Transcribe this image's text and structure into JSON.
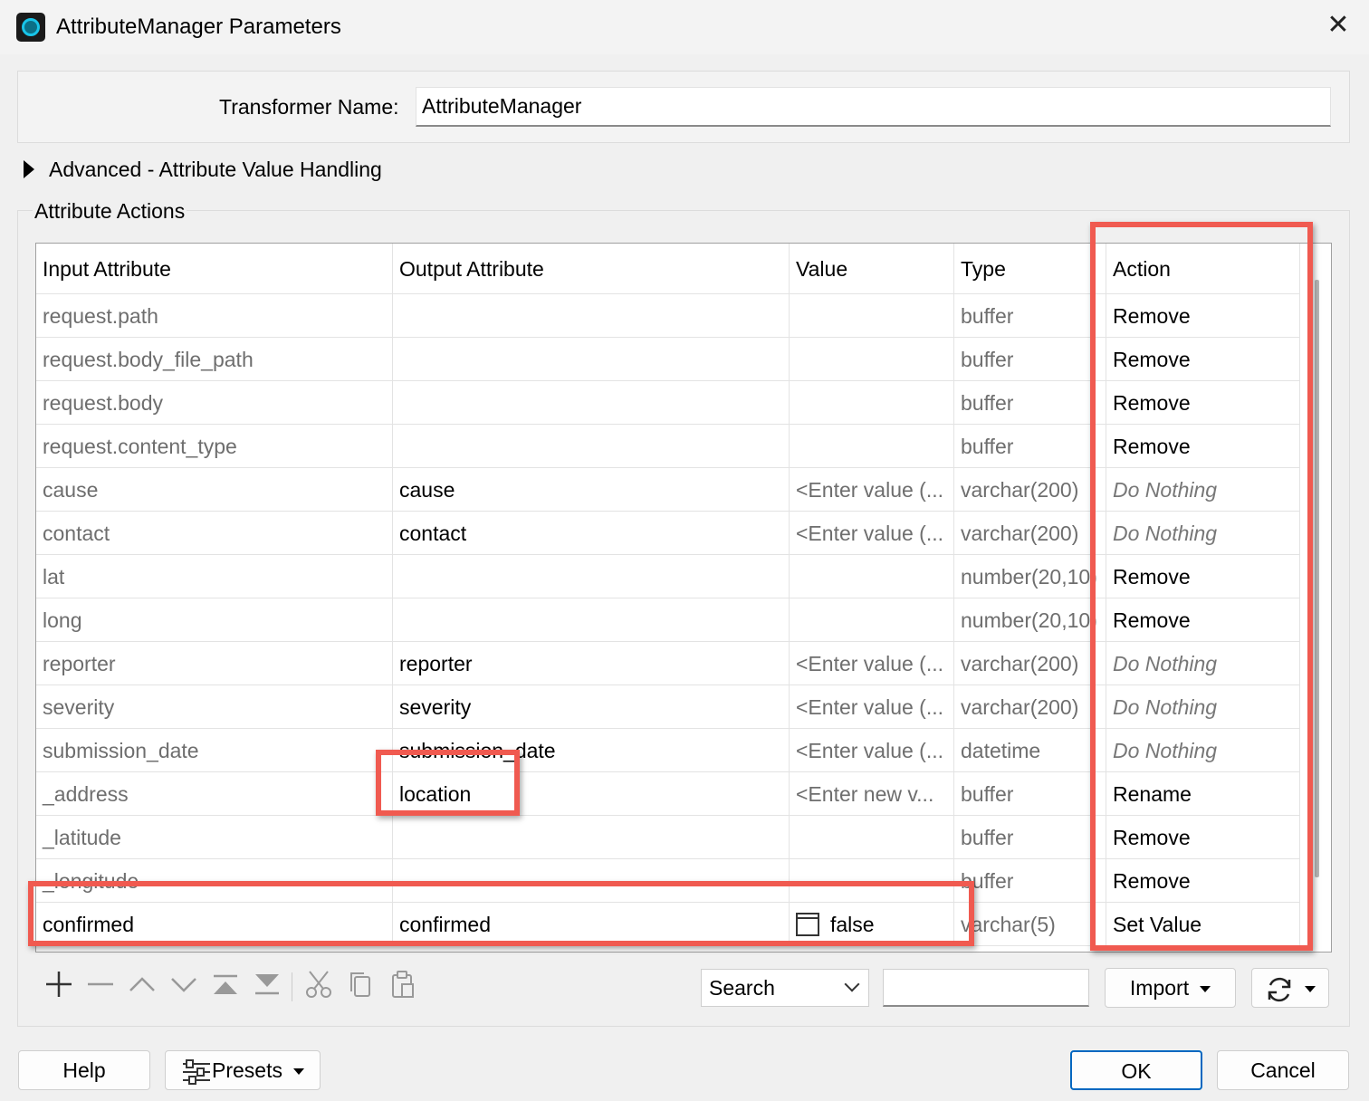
{
  "window": {
    "title": "AttributeManager Parameters",
    "close_glyph": "✕",
    "icon": "fme-app-icon"
  },
  "transformer": {
    "label": "Transformer Name:",
    "value": "AttributeManager"
  },
  "advanced": {
    "label": "Advanced - Attribute Value Handling",
    "expanded": false
  },
  "attribute_actions": {
    "label": "Attribute Actions",
    "columns": [
      "Input Attribute",
      "Output Attribute",
      "Value",
      "Type",
      "Action"
    ],
    "rows": [
      {
        "input": "request.path",
        "output": "",
        "value": "",
        "type": "buffer",
        "action": "Remove"
      },
      {
        "input": "request.body_file_path",
        "output": "",
        "value": "",
        "type": "buffer",
        "action": "Remove"
      },
      {
        "input": "request.body",
        "output": "",
        "value": "",
        "type": "buffer",
        "action": "Remove"
      },
      {
        "input": "request.content_type",
        "output": "",
        "value": "",
        "type": "buffer",
        "action": "Remove"
      },
      {
        "input": "cause",
        "output": "cause",
        "value": "<Enter value (...",
        "type": "varchar(200)",
        "action": "Do Nothing"
      },
      {
        "input": "contact",
        "output": "contact",
        "value": "<Enter value (...",
        "type": "varchar(200)",
        "action": "Do Nothing"
      },
      {
        "input": "lat",
        "output": "",
        "value": "",
        "type": "number(20,10)",
        "action": "Remove"
      },
      {
        "input": "long",
        "output": "",
        "value": "",
        "type": "number(20,10)",
        "action": "Remove"
      },
      {
        "input": "reporter",
        "output": "reporter",
        "value": "<Enter value (...",
        "type": "varchar(200)",
        "action": "Do Nothing"
      },
      {
        "input": "severity",
        "output": "severity",
        "value": "<Enter value (...",
        "type": "varchar(200)",
        "action": "Do Nothing"
      },
      {
        "input": "submission_date",
        "output": "submission_date",
        "value": "<Enter value (...",
        "type": "datetime",
        "action": "Do Nothing"
      },
      {
        "input": "_address",
        "output": "location",
        "value": "<Enter new v...",
        "type": "buffer",
        "action": "Rename"
      },
      {
        "input": "_latitude",
        "output": "",
        "value": "",
        "type": "buffer",
        "action": "Remove"
      },
      {
        "input": "_longitude",
        "output": "",
        "value": "",
        "type": "buffer",
        "action": "Remove"
      },
      {
        "input": "confirmed",
        "output": "confirmed",
        "value": "false",
        "type": "varchar(5)",
        "action": "Set Value"
      }
    ]
  },
  "highlight_color": "#f05a50",
  "toolbar": {
    "icons": [
      "add-icon",
      "remove-icon",
      "move-up-icon",
      "move-down-icon",
      "move-top-icon",
      "move-bottom-icon",
      "cut-icon",
      "copy-icon",
      "paste-icon"
    ],
    "search_mode": "Search",
    "search_value": "",
    "import_label": "Import",
    "refresh_icon": "refresh-icon"
  },
  "footer": {
    "help_label": "Help",
    "presets_label": "Presets",
    "ok_label": "OK",
    "cancel_label": "Cancel"
  }
}
